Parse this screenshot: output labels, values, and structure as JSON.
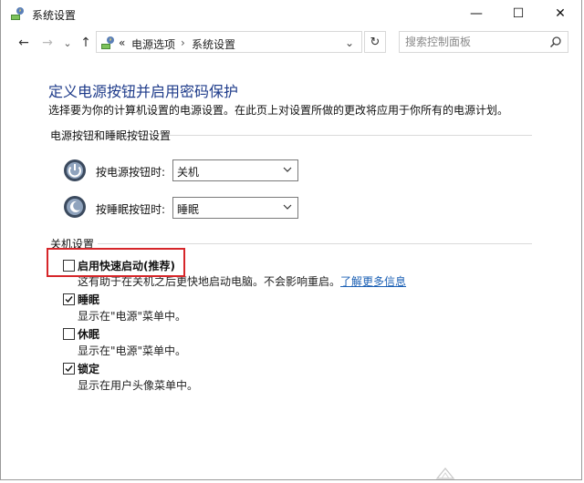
{
  "window": {
    "title": "系统设置",
    "minimize": "—",
    "maximize": "☐",
    "close": "✕"
  },
  "nav": {
    "back": "←",
    "forward": "→",
    "dropdown": "⌄",
    "up": "↑",
    "address_prefix": "«",
    "breadcrumb": [
      "电源选项",
      "系统设置"
    ],
    "breadcrumb_sep": "›",
    "address_dropdown": "⌄",
    "refresh": "↻",
    "search_placeholder": "搜索控制面板"
  },
  "page": {
    "heading": "定义电源按钮并启用密码保护",
    "description": "选择要为你的计算机设置的电源设置。在此页上对设置所做的更改将应用于你所有的电源计划。"
  },
  "buttons_section": {
    "title": "电源按钮和睡眠按钮设置",
    "rows": [
      {
        "label": "按电源按钮时:",
        "value": "关机"
      },
      {
        "label": "按睡眠按钮时:",
        "value": "睡眠"
      }
    ]
  },
  "shutdown_section": {
    "title": "关机设置",
    "options": [
      {
        "label": "启用快速启动(推荐)",
        "checked": false,
        "desc": "这有助于在关机之后更快地启动电脑。不会影响重启。",
        "link": "了解更多信息"
      },
      {
        "label": "睡眠",
        "checked": true,
        "desc": "显示在\"电源\"菜单中。"
      },
      {
        "label": "休眠",
        "checked": false,
        "desc": "显示在\"电源\"菜单中。"
      },
      {
        "label": "锁定",
        "checked": true,
        "desc": "显示在用户头像菜单中。"
      }
    ]
  },
  "colors": {
    "heading": "#1e3b8a",
    "link": "#1a5fb4",
    "highlight": "#d6262a"
  }
}
